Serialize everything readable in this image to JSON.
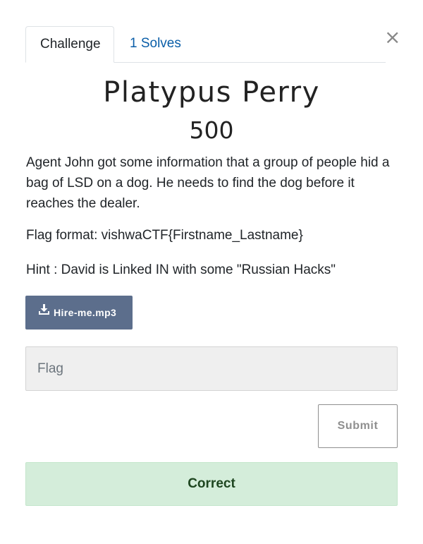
{
  "dialog": {
    "close_glyph": "×"
  },
  "tabs": [
    {
      "label": "Challenge",
      "active": true
    },
    {
      "label": "1 Solves",
      "active": false
    }
  ],
  "challenge": {
    "name": "Platypus Perry",
    "value": "500",
    "description": [
      "Agent John got some information that a group of people hid a bag of LSD on a dog. He needs to find the dog before it reaches the dealer.",
      "Flag format: vishwaCTF{Firstname_Lastname}",
      "Hint : David is Linked IN with some \"Russian Hacks\""
    ],
    "file": {
      "label": "Hire-me.mp3",
      "icon": "download-icon"
    }
  },
  "form": {
    "flag_placeholder": "Flag",
    "flag_value": "",
    "submit_label": "Submit"
  },
  "result": {
    "message": "Correct",
    "status_color": "#d4edda"
  },
  "colors": {
    "link": "#0a5ea8",
    "download_button": "#5c6e8c",
    "success_bg": "#d4edda",
    "success_text": "#1e4620"
  }
}
